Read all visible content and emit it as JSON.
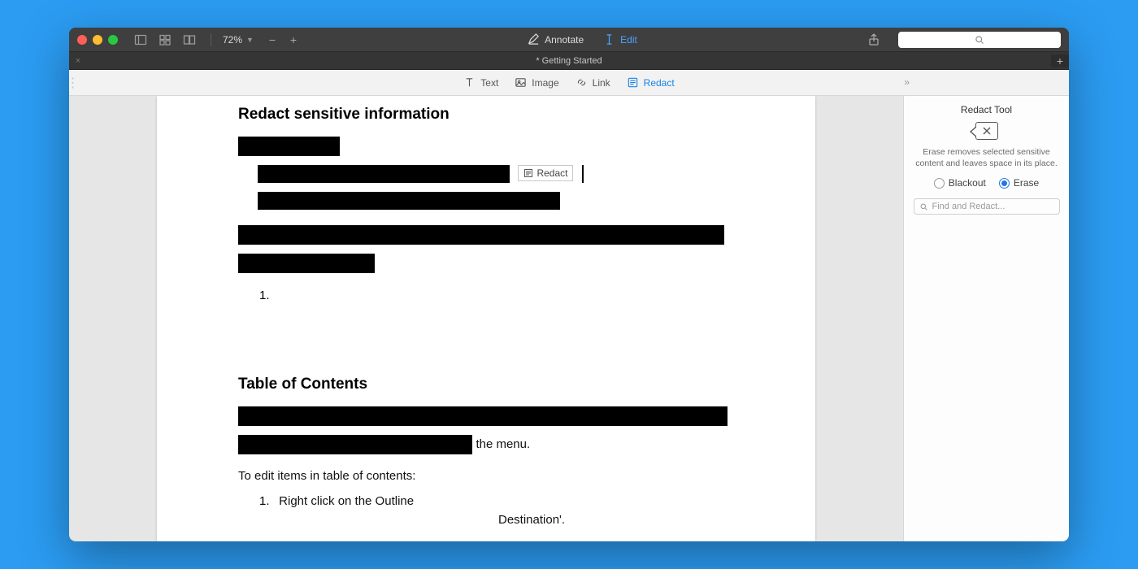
{
  "titlebar": {
    "zoom_level": "72%",
    "mode_annotate": "Annotate",
    "mode_edit": "Edit"
  },
  "tab": {
    "title": "* Getting Started"
  },
  "edit_tools": {
    "text": "Text",
    "image": "Image",
    "link": "Link",
    "redact": "Redact"
  },
  "document": {
    "heading1": "Redact sensitive information",
    "redact_tag": "Redact",
    "list1_num": "1.",
    "heading2": "Table of Contents",
    "toc_trail": " the menu.",
    "toc_instr": "To edit items in table of contents:",
    "toc_step_num": "1.",
    "toc_step_text": "Right click on the Outline",
    "dest_trail": "Destination'."
  },
  "sidebar": {
    "title": "Redact Tool",
    "desc": "Erase removes selected sensitive content and leaves space in its place.",
    "opt_blackout": "Blackout",
    "opt_erase": "Erase",
    "find_placeholder": "Find and Redact..."
  }
}
